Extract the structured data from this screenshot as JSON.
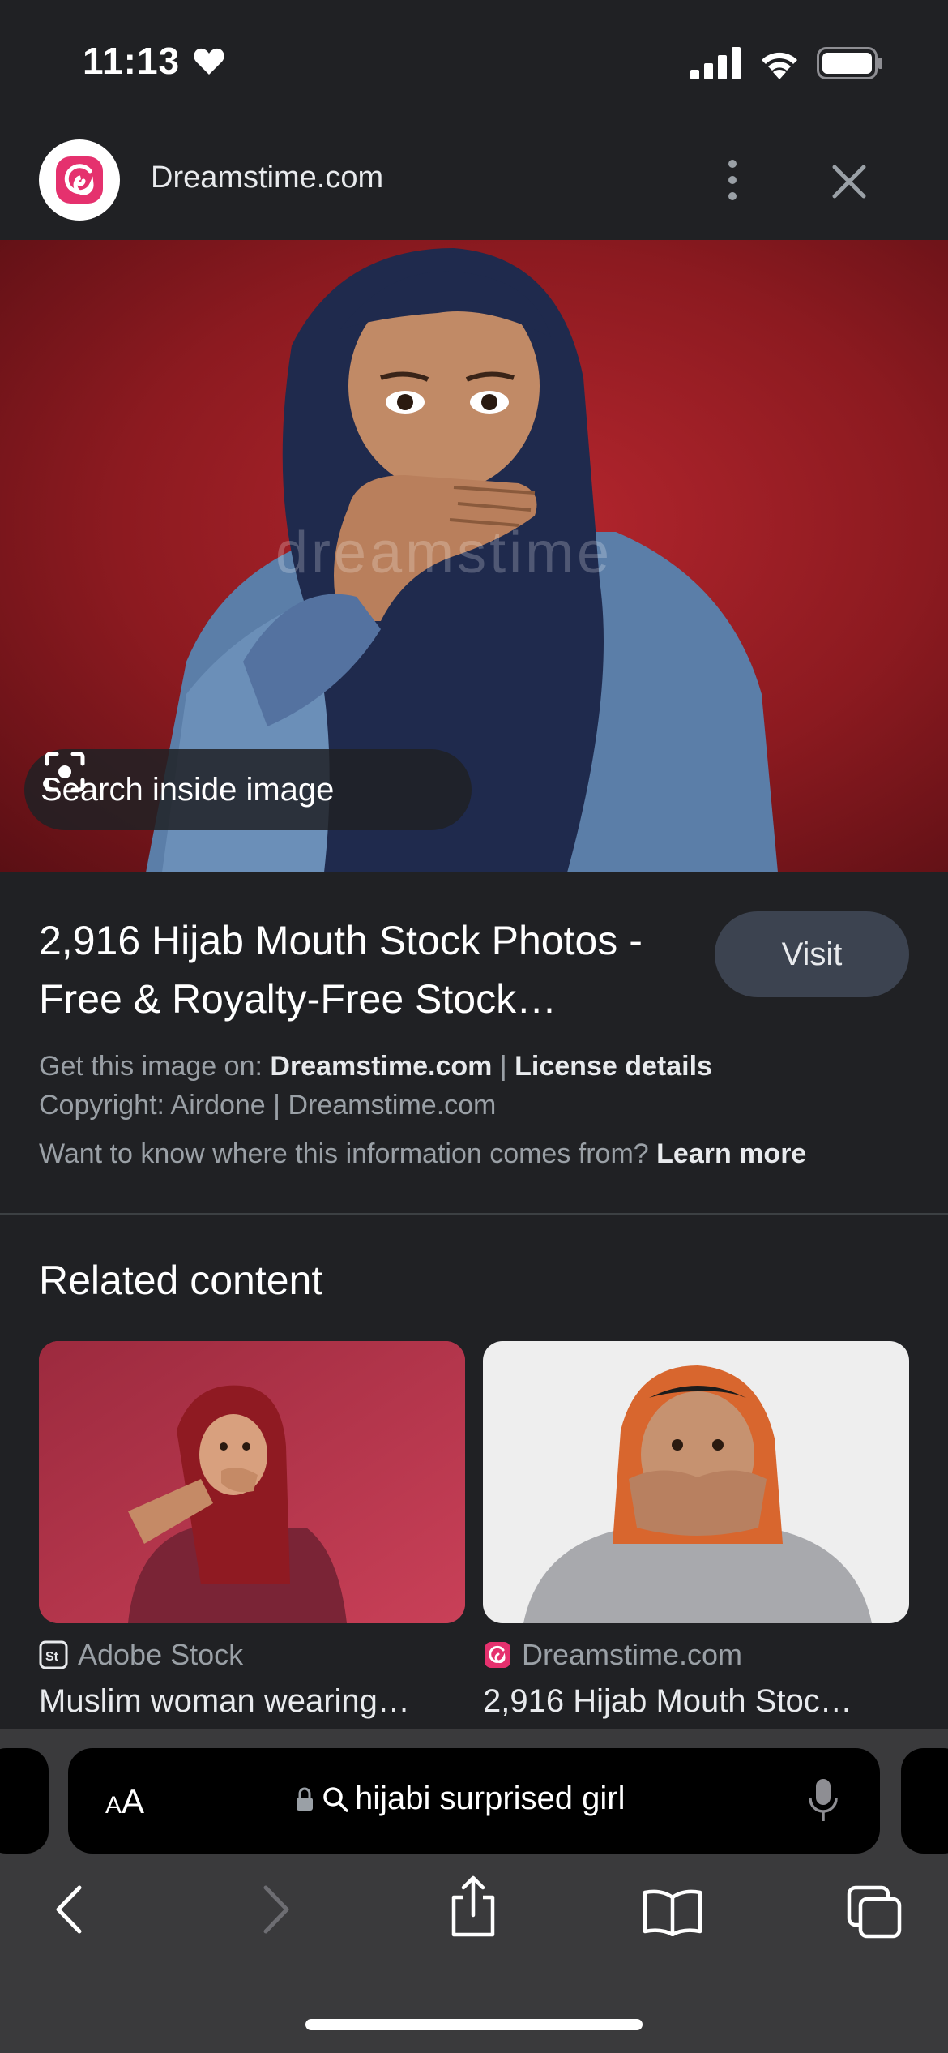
{
  "status_bar": {
    "time": "11:13"
  },
  "site": {
    "name": "Dreamstime.com"
  },
  "image_overlay": {
    "search_inside_label": "Search inside image",
    "watermark": "dreamstime"
  },
  "result": {
    "title": "2,916 Hijab Mouth Stock Photos - Free & Royalty-Free Stock…",
    "visit_label": "Visit",
    "get_image_prefix": "Get this image on:",
    "get_image_source": "Dreamstime.com",
    "separator": "|",
    "license_details": "License details",
    "copyright": "Copyright: Airdone | Dreamstime.com",
    "info_question": "Want to know where this information comes from?",
    "learn_more": "Learn more"
  },
  "related": {
    "title": "Related content",
    "items": [
      {
        "source": "Adobe Stock",
        "title": "Muslim woman wearing…"
      },
      {
        "source": "Dreamstime.com",
        "title": "2,916 Hijab Mouth Stoc…"
      }
    ]
  },
  "browser": {
    "aa_label_big": "A",
    "aa_label_small": "A",
    "url_text": "hijabi surprised girl"
  },
  "colors": {
    "background": "#202124",
    "toolbar": "#3a3a3c",
    "visit_button": "#3c4350",
    "brand_pink": "#e5316e"
  }
}
